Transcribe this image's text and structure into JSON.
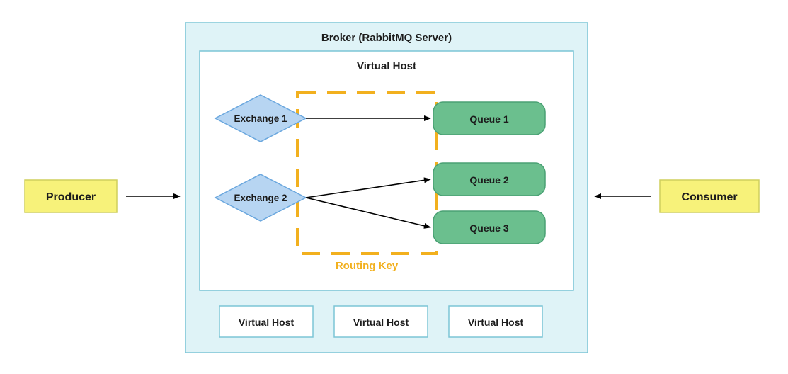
{
  "diagram": {
    "producer": "Producer",
    "consumer": "Consumer",
    "broker_title": "Broker  (RabbitMQ Server)",
    "virtual_host_main": "Virtual Host",
    "exchange1": "Exchange 1",
    "exchange2": "Exchange 2",
    "queue1": "Queue 1",
    "queue2": "Queue 2",
    "queue3": "Queue 3",
    "routing_key": "Routing Key",
    "vh_small_1": "Virtual Host",
    "vh_small_2": "Virtual Host",
    "vh_small_3": "Virtual Host"
  },
  "colors": {
    "broker_fill": "#dff3f7",
    "broker_stroke": "#7cc5d6",
    "vh_stroke": "#7cc5d6",
    "exchange_fill": "#b7d5f2",
    "exchange_stroke": "#6aa7de",
    "queue_fill": "#6bbf8e",
    "queue_stroke": "#4aa174",
    "routing_stroke": "#f2b01e",
    "producer_fill": "#f7f27a",
    "producer_stroke": "#cfcf5c",
    "arrow": "#000000",
    "text": "#1c1c1c"
  }
}
